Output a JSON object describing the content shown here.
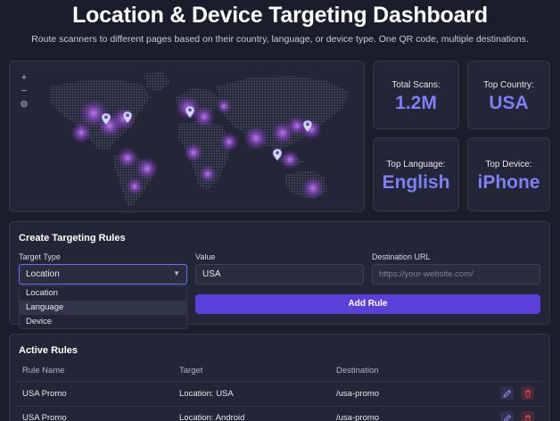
{
  "header": {
    "title": "Location & Device Targeting Dashboard",
    "subtitle": "Route scanners to different pages based on their country, language, or device type. One QR code, multiple destinations."
  },
  "map": {
    "zoom_in": "+",
    "zoom_out": "−",
    "reset": "⊚"
  },
  "stats": [
    {
      "label": "Total Scans:",
      "value": "1.2M"
    },
    {
      "label": "Top Country:",
      "value": "USA"
    },
    {
      "label": "Top Language:",
      "value": "English"
    },
    {
      "label": "Top Device:",
      "value": "iPhone"
    }
  ],
  "create_rules": {
    "title": "Create Targeting Rules",
    "target_type_label": "Target Type",
    "target_type_value": "Location",
    "value_label": "Value",
    "value_value": "USA",
    "destination_label": "Destination URL",
    "destination_placeholder": "https://your-website.com/",
    "add_button": "Add Rule",
    "options": [
      "Location",
      "Language",
      "Device"
    ]
  },
  "active_rules": {
    "title": "Active Rules",
    "columns": [
      "Rule Name",
      "Target",
      "Destination"
    ],
    "rows": [
      {
        "name": "USA Promo",
        "target": "Location: USA",
        "destination": "/usa-promo"
      },
      {
        "name": "USA Promo",
        "target": "Location: Android",
        "destination": "/usa-promo"
      }
    ]
  },
  "colors": {
    "accent": "#7c7ff5",
    "button": "#5b3fd9",
    "danger": "#e0455a"
  }
}
